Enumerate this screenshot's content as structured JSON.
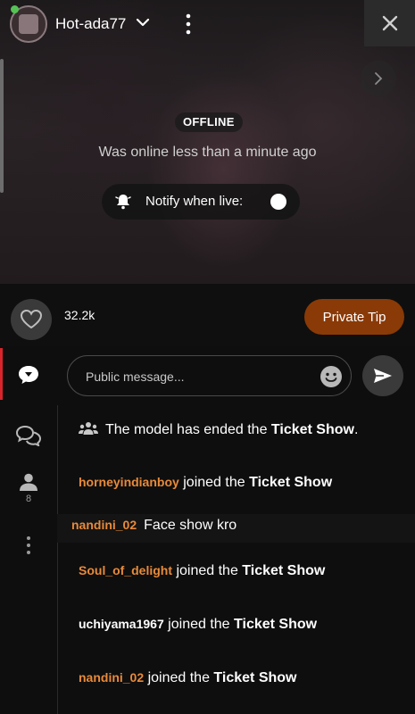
{
  "header": {
    "username": "Hot-ada77"
  },
  "stream": {
    "status_badge": "OFFLINE",
    "last_seen": "Was online less than a minute ago",
    "notify_label": "Notify when live:"
  },
  "actions": {
    "like_count": "32.2k",
    "private_tip_label": "Private Tip"
  },
  "rail": {
    "viewers_count": "8"
  },
  "chat": {
    "input_placeholder": "Public message...",
    "system_message": {
      "prefix": "The model has ended the ",
      "bold": "Ticket Show",
      "suffix": "."
    },
    "messages": [
      {
        "user": "horneyindianboy",
        "text": " joined the ",
        "bold": "Ticket Show"
      },
      {
        "user": "nandini_02",
        "text": "Face show kro",
        "bold": ""
      },
      {
        "user": "Soul_of_delight",
        "text": " joined the ",
        "bold": "Ticket Show"
      },
      {
        "user": "uchiyama1967",
        "text": " joined the ",
        "bold": "Ticket Show"
      },
      {
        "user": "nandini_02",
        "text": " joined the ",
        "bold": "Ticket Show"
      }
    ]
  },
  "colors": {
    "accent_tip": "#8a3a06",
    "username_orange": "#e88a3a",
    "active_tab": "#d9242b",
    "online_dot": "#55c255"
  },
  "icons": [
    "chevron-down-icon",
    "kebab-icon",
    "close-icon",
    "chevron-right-icon",
    "bell-icon",
    "heart-icon",
    "chat-bubble-icon",
    "chats-icon",
    "user-icon",
    "emoji-icon",
    "send-icon",
    "group-icon"
  ]
}
